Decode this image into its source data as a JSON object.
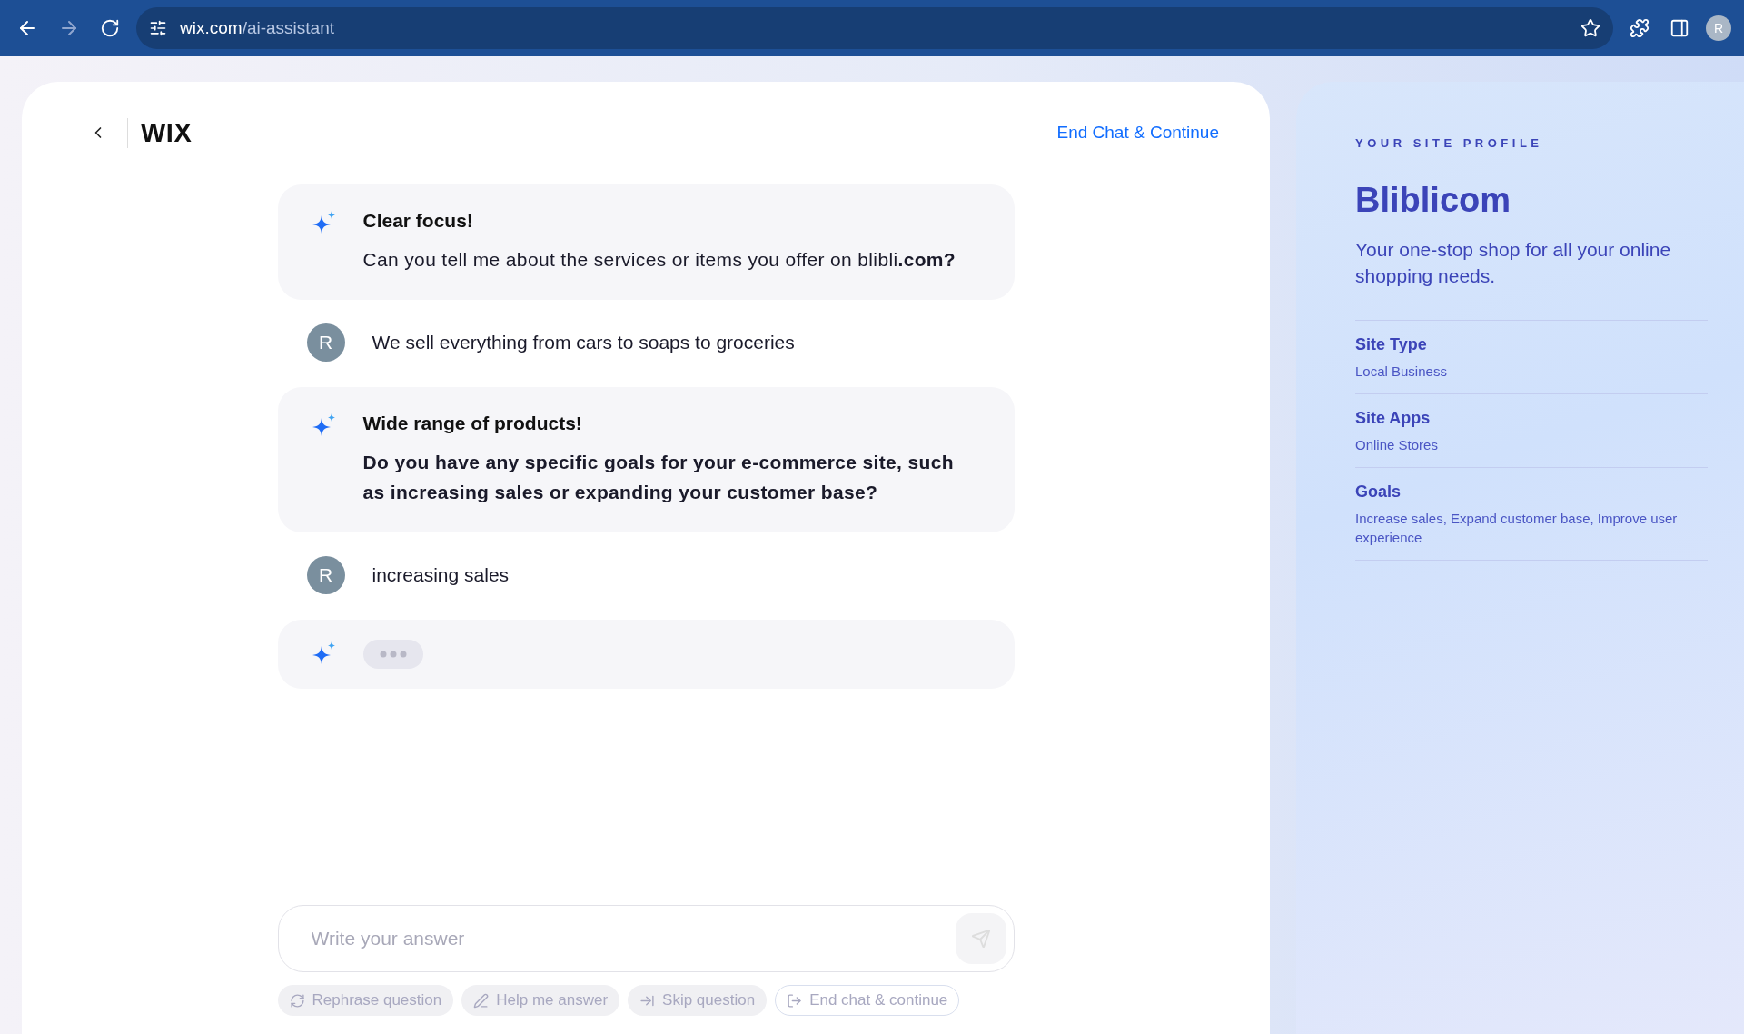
{
  "browser": {
    "url_host": "wix.com",
    "url_path": "/ai-assistant",
    "profile_initial": "R"
  },
  "header": {
    "logo": "WIX",
    "end_link": "End Chat & Continue"
  },
  "messages": [
    {
      "kind": "ai",
      "title": "Clear focus!",
      "body": "Can you tell me about the services or items you offer on blibli**.com?**",
      "bold": false
    },
    {
      "kind": "user",
      "initial": "R",
      "text": "We sell everything from cars to soaps to groceries"
    },
    {
      "kind": "ai",
      "title": "Wide range of products!",
      "body": "Do you have any specific goals for your e-commerce site, such as increasing sales or expanding your customer base?",
      "bold": true
    },
    {
      "kind": "user",
      "initial": "R",
      "text": "increasing sales"
    },
    {
      "kind": "typing"
    }
  ],
  "composer": {
    "placeholder": "Write your answer"
  },
  "actions": [
    {
      "kind": "rephrase",
      "label": "Rephrase question",
      "outlined": false
    },
    {
      "kind": "help",
      "label": "Help me answer",
      "outlined": false
    },
    {
      "kind": "skip",
      "label": "Skip question",
      "outlined": false
    },
    {
      "kind": "end",
      "label": "End chat & continue",
      "outlined": true
    }
  ],
  "profile": {
    "eyebrow": "YOUR SITE PROFILE",
    "name": "Bliblicom",
    "tagline": "Your one-stop shop for all your online shopping needs.",
    "fields": [
      {
        "label": "Site Type",
        "value": "Local Business"
      },
      {
        "label": "Site Apps",
        "value": "Online Stores"
      },
      {
        "label": "Goals",
        "value": "Increase sales, Expand customer base, Improve user experience"
      }
    ]
  }
}
